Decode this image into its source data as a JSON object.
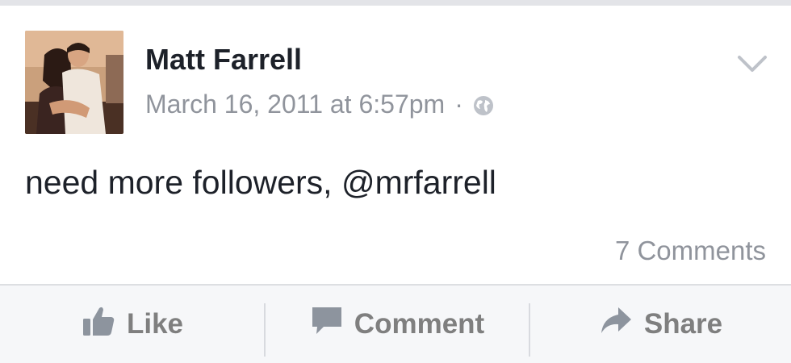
{
  "post": {
    "author": "Matt Farrell",
    "timestamp": "March 16, 2011 at 6:57pm",
    "separator": "·",
    "privacy_icon": "globe-icon",
    "menu_icon": "chevron-down-icon",
    "text": "need more followers, @mrfarrell",
    "comments_count": "7 Comments"
  },
  "actions": {
    "like_label": "Like",
    "comment_label": "Comment",
    "share_label": "Share",
    "like_icon": "thumbs-up-icon",
    "comment_icon": "speech-bubble-icon",
    "share_icon": "share-arrow-icon"
  },
  "colors": {
    "name_text": "#1d2129",
    "meta_text": "#90949c",
    "action_text": "#7f7f7f",
    "action_bar_bg": "#f6f7f9",
    "top_strip": "#e3e4e8"
  }
}
